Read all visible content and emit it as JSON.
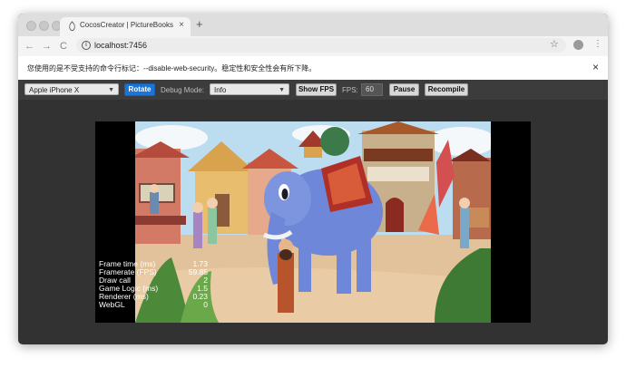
{
  "browser": {
    "tab_title": "CocosCreator | PictureBooks",
    "tab_close": "×",
    "new_tab": "+",
    "url": "localhost:7456",
    "nav": {
      "back": "←",
      "forward": "→",
      "reload": "C"
    },
    "star": "☆",
    "menu": "⋮"
  },
  "infobar": {
    "message": "您使用的是不受支持的命令行标记：--disable-web-security。稳定性和安全性会有所下降。",
    "close": "×"
  },
  "devbar": {
    "device": "Apple iPhone X",
    "rotate": "Rotate",
    "debug_mode_label": "Debug Mode:",
    "debug_mode": "Info",
    "show_fps": "Show FPS",
    "fps_label": "FPS:",
    "fps_value": "60",
    "pause": "Pause",
    "recompile": "Recompile"
  },
  "stats": [
    {
      "label": "Frame time (ms)",
      "value": "1.73"
    },
    {
      "label": "Framerate (FPS)",
      "value": "59.85"
    },
    {
      "label": "Draw call",
      "value": "2"
    },
    {
      "label": "Game Logic (ms)",
      "value": "1.5"
    },
    {
      "label": "Renderer (ms)",
      "value": "0.23"
    },
    {
      "label": "WebGL",
      "value": "0"
    }
  ],
  "colors": {
    "chrome_bg": "#323232",
    "accent_button": "#1a75d8",
    "elephant": "#6f87d8",
    "sky": "#bcdcf0",
    "ground": "#e2c29a"
  },
  "icons": [
    "back-arrow-icon",
    "forward-arrow-icon",
    "reload-icon",
    "info-icon",
    "star-icon",
    "profile-icon",
    "menu-icon",
    "close-icon",
    "cocos-tab-icon"
  ]
}
